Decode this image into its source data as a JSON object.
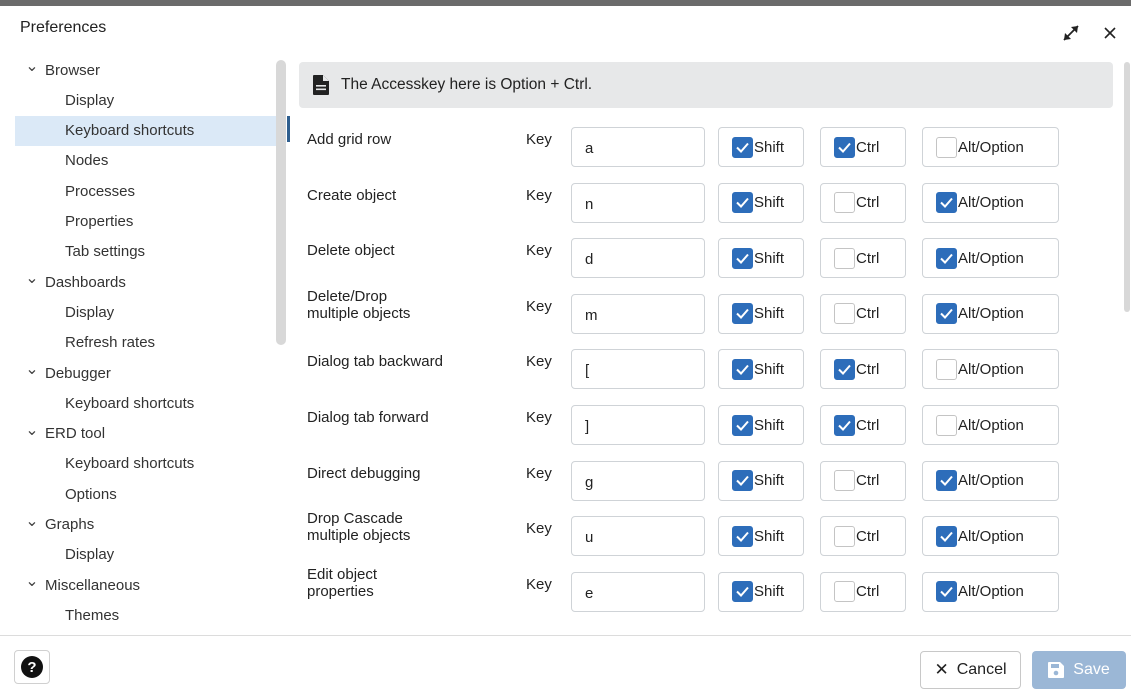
{
  "dialog": {
    "title": "Preferences"
  },
  "sidebar": {
    "items": [
      {
        "label": "Browser",
        "kind": "parent",
        "expanded": true
      },
      {
        "label": "Display",
        "kind": "child"
      },
      {
        "label": "Keyboard shortcuts",
        "kind": "child",
        "selected": true
      },
      {
        "label": "Nodes",
        "kind": "child"
      },
      {
        "label": "Processes",
        "kind": "child"
      },
      {
        "label": "Properties",
        "kind": "child"
      },
      {
        "label": "Tab settings",
        "kind": "child"
      },
      {
        "label": "Dashboards",
        "kind": "parent",
        "expanded": true
      },
      {
        "label": "Display",
        "kind": "child"
      },
      {
        "label": "Refresh rates",
        "kind": "child"
      },
      {
        "label": "Debugger",
        "kind": "parent",
        "expanded": true
      },
      {
        "label": "Keyboard shortcuts",
        "kind": "child"
      },
      {
        "label": "ERD tool",
        "kind": "parent",
        "expanded": true
      },
      {
        "label": "Keyboard shortcuts",
        "kind": "child"
      },
      {
        "label": "Options",
        "kind": "child"
      },
      {
        "label": "Graphs",
        "kind": "parent",
        "expanded": true
      },
      {
        "label": "Display",
        "kind": "child"
      },
      {
        "label": "Miscellaneous",
        "kind": "parent",
        "expanded": true
      },
      {
        "label": "Themes",
        "kind": "child"
      }
    ]
  },
  "main": {
    "info_text": "The Accesskey here is Option + Ctrl.",
    "key_label": "Key",
    "shift_label": "Shift",
    "ctrl_label": "Ctrl",
    "alt_label": "Alt/Option",
    "shortcuts": [
      {
        "name": "Add grid row",
        "key": "a",
        "shift": true,
        "ctrl": true,
        "alt": false
      },
      {
        "name": "Create object",
        "key": "n",
        "shift": true,
        "ctrl": false,
        "alt": true
      },
      {
        "name": "Delete object",
        "key": "d",
        "shift": true,
        "ctrl": false,
        "alt": true
      },
      {
        "name": "Delete/Drop\nmultiple objects",
        "key": "m",
        "shift": true,
        "ctrl": false,
        "alt": true
      },
      {
        "name": "Dialog tab backward",
        "key": "[",
        "shift": true,
        "ctrl": true,
        "alt": false
      },
      {
        "name": "Dialog tab forward",
        "key": "]",
        "shift": true,
        "ctrl": true,
        "alt": false
      },
      {
        "name": "Direct debugging",
        "key": "g",
        "shift": true,
        "ctrl": false,
        "alt": true
      },
      {
        "name": "Drop Cascade\nmultiple objects",
        "key": "u",
        "shift": true,
        "ctrl": false,
        "alt": true
      },
      {
        "name": "Edit object\nproperties",
        "key": "e",
        "shift": true,
        "ctrl": false,
        "alt": true
      }
    ]
  },
  "footer": {
    "help_label": "?",
    "cancel_label": "Cancel",
    "save_label": "Save"
  },
  "colors": {
    "accent": "#2d6dba",
    "selected_bg": "#dbe9f7",
    "save_disabled": "#9bb7d6",
    "banner_bg": "#e7e8e9"
  }
}
